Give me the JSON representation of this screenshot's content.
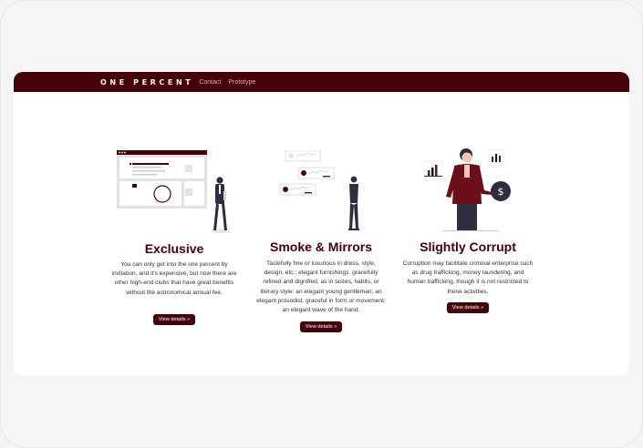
{
  "navbar": {
    "brand": "ONE PERCENT",
    "links": [
      "Contact",
      "Prototype"
    ]
  },
  "features": [
    {
      "title": "Exclusive",
      "description": "You can only get into the one percent by invitation, and it's expensive, but now there are other high-end clubs that have great benefits without the astronomical annual fee.",
      "button": "View details »"
    },
    {
      "title": "Smoke & Mirrors",
      "description": "Tastefully fine or luxurious in dress, style, design, etc.: elegant furnishings. gracefully refined and dignified, as in tastes, habits, or literary style: an elegant young gentleman; an elegant prosodist. graceful in form or movement: an elegant wave of the hand.",
      "button": "View details »"
    },
    {
      "title": "Slightly Corrupt",
      "description": "Corruption may facilitate criminal enterprise such as drug trafficking, money laundering, and human trafficking, though it is not restricted to these activities.",
      "button": "View details »"
    }
  ],
  "colors": {
    "brand": "#470008",
    "accent": "#6b0f1a",
    "page_bg": "#ffffff"
  }
}
